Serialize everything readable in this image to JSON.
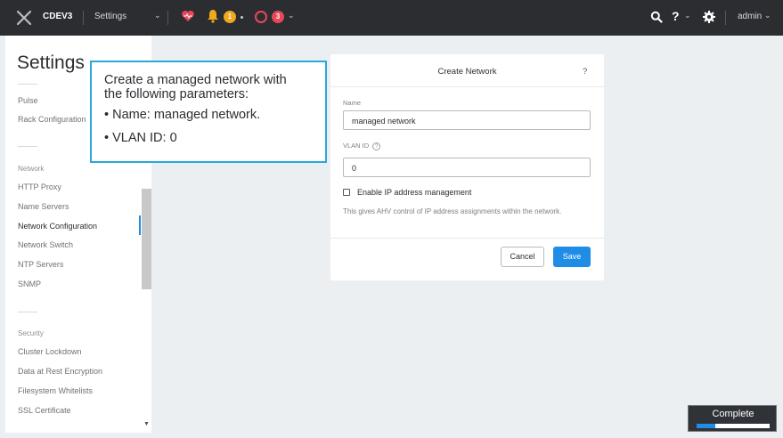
{
  "topbar": {
    "cluster_name": "CDEV3",
    "nav_label": "Settings",
    "alerts_warning_count": "1",
    "alerts_critical_count": "3",
    "user_label": "admin",
    "help_label": "?",
    "colors": {
      "background": "#2b2d31",
      "warning": "#f0a91d",
      "critical": "#e8475a"
    }
  },
  "sidebar": {
    "title": "Settings",
    "items_top": [
      {
        "label": "Pulse"
      },
      {
        "label": "Rack Configuration"
      }
    ],
    "group_network": "Network",
    "network_items": [
      {
        "label": "HTTP Proxy"
      },
      {
        "label": "Name Servers"
      },
      {
        "label": "Network Configuration",
        "active": true
      },
      {
        "label": "Network Switch"
      },
      {
        "label": "NTP Servers"
      },
      {
        "label": "SNMP"
      }
    ],
    "group_security": "Security",
    "security_items": [
      {
        "label": "Cluster Lockdown"
      },
      {
        "label": "Data at Rest Encryption"
      },
      {
        "label": "Filesystem Whitelists"
      },
      {
        "label": "SSL Certificate"
      }
    ]
  },
  "callout": {
    "intro": "Create a managed network with",
    "intro2": "the following parameters:",
    "bullet1": "• Name: managed network.",
    "bullet2": "• VLAN ID: 0"
  },
  "dialog": {
    "title": "Create Network",
    "help": "?",
    "name_label": "Name",
    "name_value": "managed network",
    "vlan_label": "VLAN ID",
    "vlan_value": "0",
    "ipam_label": "Enable IP address management",
    "ipam_checked": false,
    "ipam_help": "This gives AHV control of IP address assignments within the network.",
    "cancel_label": "Cancel",
    "save_label": "Save",
    "accent_color": "#1f8ce6"
  },
  "progress": {
    "label": "Complete",
    "fraction": 0.25
  }
}
